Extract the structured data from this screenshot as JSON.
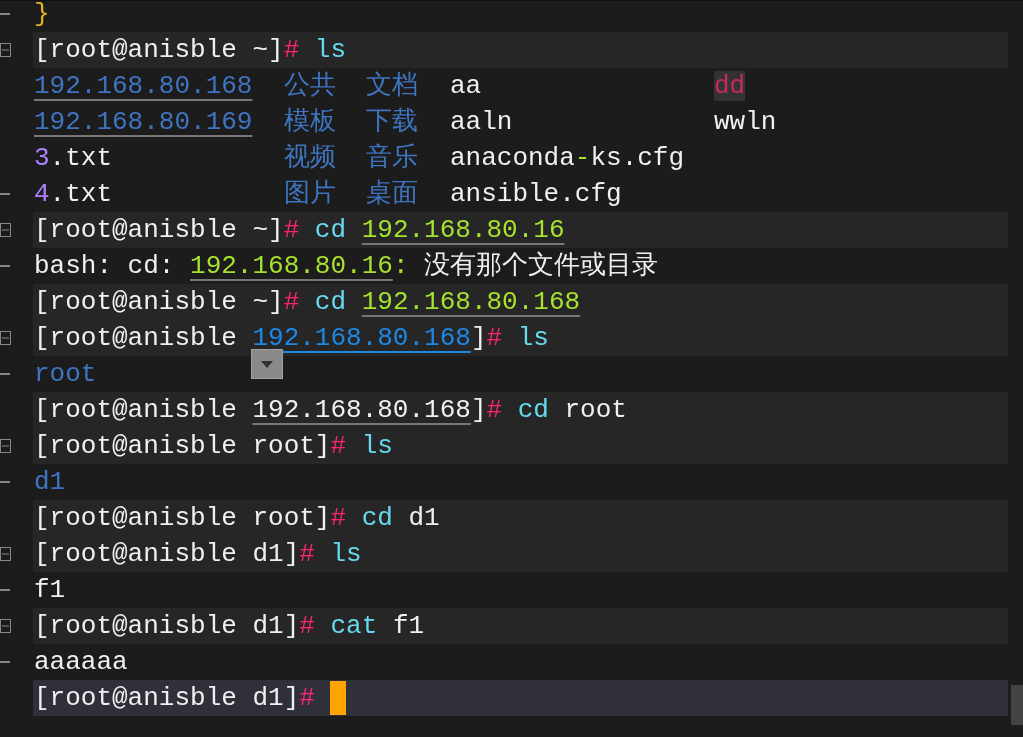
{
  "lines": [
    {
      "kind": "output",
      "fold_start": false,
      "fold_line": true,
      "segments": [
        {
          "text": "}",
          "kind": "brace"
        }
      ]
    },
    {
      "kind": "prompt",
      "fold_start": true,
      "fold_line": false,
      "segments": [
        {
          "text": "[root@anisble ~]",
          "kind": "plain"
        },
        {
          "text": "# ",
          "kind": "hash"
        },
        {
          "text": "ls",
          "kind": "cmd"
        }
      ]
    },
    {
      "kind": "columns",
      "fold_start": false,
      "fold_line": false,
      "cells": [
        [
          {
            "text": "192.168.80.168",
            "kind": "dir-link"
          }
        ],
        [
          {
            "text": "公共",
            "kind": "dir"
          }
        ],
        [
          {
            "text": "文档",
            "kind": "dir"
          }
        ],
        [
          {
            "text": "aa",
            "kind": "plain"
          }
        ],
        [
          {
            "text": "dd",
            "kind": "archive"
          }
        ]
      ]
    },
    {
      "kind": "columns",
      "fold_start": false,
      "fold_line": false,
      "cells": [
        [
          {
            "text": "192.168.80.169",
            "kind": "dir-link"
          }
        ],
        [
          {
            "text": "模板",
            "kind": "dir"
          }
        ],
        [
          {
            "text": "下载",
            "kind": "dir"
          }
        ],
        [
          {
            "text": "aaln",
            "kind": "plain"
          }
        ],
        [
          {
            "text": "wwln",
            "kind": "plain"
          }
        ]
      ]
    },
    {
      "kind": "columns",
      "fold_start": false,
      "fold_line": false,
      "cells": [
        [
          {
            "text": "3",
            "kind": "num"
          },
          {
            "text": ".txt",
            "kind": "plain"
          }
        ],
        [
          {
            "text": "视频",
            "kind": "dir"
          }
        ],
        [
          {
            "text": "音乐",
            "kind": "dir"
          }
        ],
        [
          {
            "text": "anaconda",
            "kind": "plain"
          },
          {
            "text": "-",
            "kind": "dash"
          },
          {
            "text": "ks.cfg",
            "kind": "plain"
          }
        ]
      ]
    },
    {
      "kind": "columns",
      "fold_start": false,
      "fold_line": true,
      "cells": [
        [
          {
            "text": "4",
            "kind": "num"
          },
          {
            "text": ".txt",
            "kind": "plain"
          }
        ],
        [
          {
            "text": "图片",
            "kind": "dir"
          }
        ],
        [
          {
            "text": "桌面",
            "kind": "dir"
          }
        ],
        [
          {
            "text": "ansible.cfg",
            "kind": "plain"
          }
        ]
      ]
    },
    {
      "kind": "prompt",
      "fold_start": true,
      "fold_line": false,
      "segments": [
        {
          "text": "[root@anisble ~]",
          "kind": "plain"
        },
        {
          "text": "# ",
          "kind": "hash"
        },
        {
          "text": "cd ",
          "kind": "cmd"
        },
        {
          "text": "192.168.80.16",
          "kind": "arg-link"
        }
      ]
    },
    {
      "kind": "output",
      "fold_start": false,
      "fold_line": true,
      "segments": [
        {
          "text": "bash: cd: ",
          "kind": "plain"
        },
        {
          "text": "192.168.80.16",
          "kind": "arg-link"
        },
        {
          "text": ": ",
          "kind": "dash"
        },
        {
          "text": "没有那个文件或目录",
          "kind": "plain"
        }
      ]
    },
    {
      "kind": "prompt",
      "fold_start": false,
      "fold_line": false,
      "segments": [
        {
          "text": "[root@anisble ~]",
          "kind": "plain"
        },
        {
          "text": "# ",
          "kind": "hash"
        },
        {
          "text": "cd ",
          "kind": "cmd"
        },
        {
          "text": "192.168.80.168",
          "kind": "arg-link"
        }
      ]
    },
    {
      "kind": "prompt",
      "fold_start": true,
      "fold_line": false,
      "segments": [
        {
          "text": "[root@anisble ",
          "kind": "plain"
        },
        {
          "text": "192.168.80.168",
          "kind": "path-active"
        },
        {
          "text": "]",
          "kind": "plain"
        },
        {
          "text": "# ",
          "kind": "hash"
        },
        {
          "text": "ls",
          "kind": "cmd"
        }
      ]
    },
    {
      "kind": "output",
      "fold_start": false,
      "fold_line": true,
      "segments": [
        {
          "text": "root",
          "kind": "dir"
        }
      ]
    },
    {
      "kind": "prompt",
      "fold_start": false,
      "fold_line": false,
      "segments": [
        {
          "text": "[root@anisble ",
          "kind": "plain"
        },
        {
          "text": "192.168.80.168",
          "kind": "path-link"
        },
        {
          "text": "]",
          "kind": "plain"
        },
        {
          "text": "# ",
          "kind": "hash"
        },
        {
          "text": "cd ",
          "kind": "cmd"
        },
        {
          "text": "root",
          "kind": "plain"
        }
      ]
    },
    {
      "kind": "prompt",
      "fold_start": true,
      "fold_line": false,
      "segments": [
        {
          "text": "[root@anisble root]",
          "kind": "plain"
        },
        {
          "text": "# ",
          "kind": "hash"
        },
        {
          "text": "ls",
          "kind": "cmd"
        }
      ]
    },
    {
      "kind": "output",
      "fold_start": false,
      "fold_line": true,
      "segments": [
        {
          "text": "d1",
          "kind": "dir"
        }
      ]
    },
    {
      "kind": "prompt",
      "fold_start": false,
      "fold_line": false,
      "segments": [
        {
          "text": "[root@anisble root]",
          "kind": "plain"
        },
        {
          "text": "# ",
          "kind": "hash"
        },
        {
          "text": "cd ",
          "kind": "cmd"
        },
        {
          "text": "d1",
          "kind": "plain"
        }
      ]
    },
    {
      "kind": "prompt",
      "fold_start": true,
      "fold_line": false,
      "segments": [
        {
          "text": "[root@anisble d1]",
          "kind": "plain"
        },
        {
          "text": "# ",
          "kind": "hash"
        },
        {
          "text": "ls",
          "kind": "cmd"
        }
      ]
    },
    {
      "kind": "output",
      "fold_start": false,
      "fold_line": true,
      "segments": [
        {
          "text": "f1",
          "kind": "plain"
        }
      ]
    },
    {
      "kind": "prompt",
      "fold_start": true,
      "fold_line": false,
      "segments": [
        {
          "text": "[root@anisble d1]",
          "kind": "plain"
        },
        {
          "text": "# ",
          "kind": "hash"
        },
        {
          "text": "cat ",
          "kind": "cmd"
        },
        {
          "text": "f1",
          "kind": "plain"
        }
      ]
    },
    {
      "kind": "output",
      "fold_start": false,
      "fold_line": true,
      "segments": [
        {
          "text": "aaaaaa",
          "kind": "plain"
        }
      ]
    },
    {
      "kind": "input",
      "fold_start": false,
      "fold_line": false,
      "segments": [
        {
          "text": "[root@anisble d1]",
          "kind": "plain"
        },
        {
          "text": "# ",
          "kind": "hash"
        }
      ]
    }
  ]
}
